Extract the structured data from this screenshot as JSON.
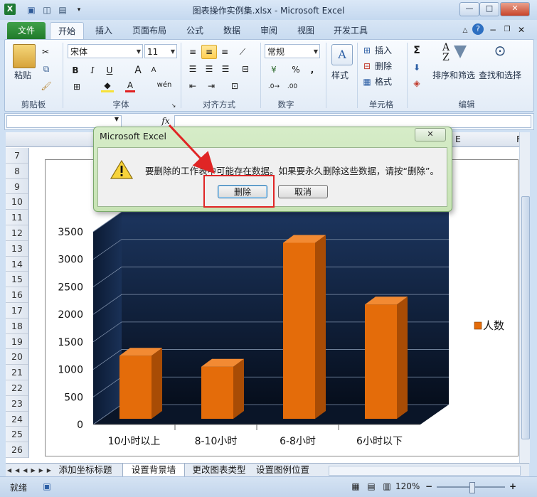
{
  "window": {
    "title": "图表操作实例集.xlsx - Microsoft Excel",
    "minimize": "—",
    "maximize": "□",
    "close": "✕"
  },
  "tabs": [
    "文件",
    "开始",
    "插入",
    "页面布局",
    "公式",
    "数据",
    "审阅",
    "视图",
    "开发工具"
  ],
  "ribbon": {
    "clipboard": {
      "paste": "粘贴",
      "group": "剪贴板"
    },
    "font": {
      "name": "宋体",
      "size": "11",
      "group": "字体",
      "bold": "B",
      "italic": "I",
      "underline": "U",
      "grow": "A",
      "shrink": "A",
      "phonetic": "wén",
      "fontcolor": "A"
    },
    "align": {
      "group": "对齐方式"
    },
    "number": {
      "format": "常规",
      "percent": "%",
      "comma": ",",
      "group": "数字"
    },
    "styles": {
      "label": "样式"
    },
    "cells": {
      "insert": "插入",
      "delete": "删除",
      "format": "格式",
      "group": "单元格"
    },
    "editing": {
      "sum": "Σ",
      "sort": "排序和筛选",
      "find": "查找和选择",
      "group": "编辑"
    }
  },
  "formula_bar": {
    "fx": "fx"
  },
  "columns": {
    "e": "E",
    "f": "F"
  },
  "rows": [
    "7",
    "8",
    "9",
    "10",
    "11",
    "12",
    "13",
    "14",
    "15",
    "16",
    "17",
    "18",
    "19",
    "20",
    "21",
    "22",
    "23",
    "24",
    "25",
    "26"
  ],
  "chart_data": {
    "type": "bar",
    "categories": [
      "10小时以上",
      "8-10小时",
      "6-8小时",
      "6小时以下"
    ],
    "series": [
      {
        "name": "人数",
        "values": [
          1250,
          1050,
          3300,
          2180
        ],
        "color": "#e46c0a"
      }
    ],
    "ylim": [
      0,
      3500
    ],
    "yticks": [
      "0",
      "500",
      "1000",
      "1500",
      "2000",
      "2500",
      "3000",
      "3500"
    ],
    "legend_position": "right",
    "grid": true,
    "wall_color": "#1c355e"
  },
  "dialog": {
    "title": "Microsoft Excel",
    "message": "要删除的工作表中可能存在数据。如果要永久删除这些数据，请按“删除”。",
    "delete": "删除",
    "cancel": "取消",
    "close": "✕"
  },
  "sheet_tabs": [
    "添加坐标标题",
    "设置背景墙",
    "更改图表类型",
    "设置图例位置"
  ],
  "status": {
    "ready": "就绪",
    "zoom": "120%",
    "zoom_out": "−",
    "zoom_in": "+"
  },
  "colors": {
    "file_tab": "#2e8b3a",
    "alert": "#e02525"
  }
}
